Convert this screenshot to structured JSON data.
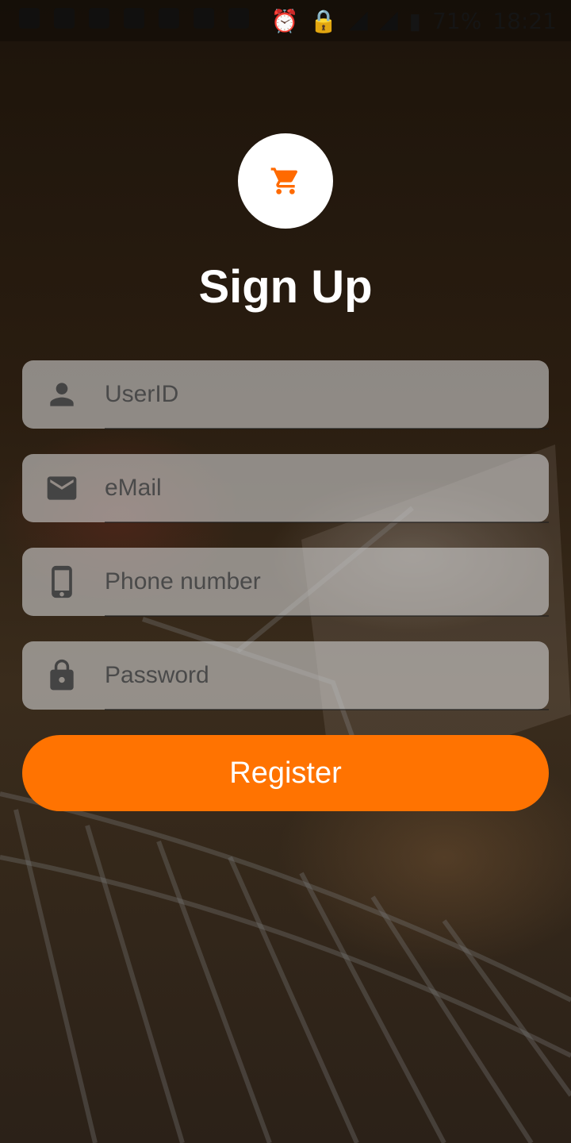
{
  "status_bar": {
    "battery": "71%",
    "time": "18:21"
  },
  "app": {
    "logo_icon": "shopping-cart-icon",
    "title": "Sign Up"
  },
  "form": {
    "userid_placeholder": "UserID",
    "email_placeholder": "eMail",
    "phone_placeholder": "Phone number",
    "password_placeholder": "Password",
    "register_label": "Register"
  },
  "colors": {
    "accent": "#ff7301",
    "field_bg": "#cdcdcd"
  }
}
